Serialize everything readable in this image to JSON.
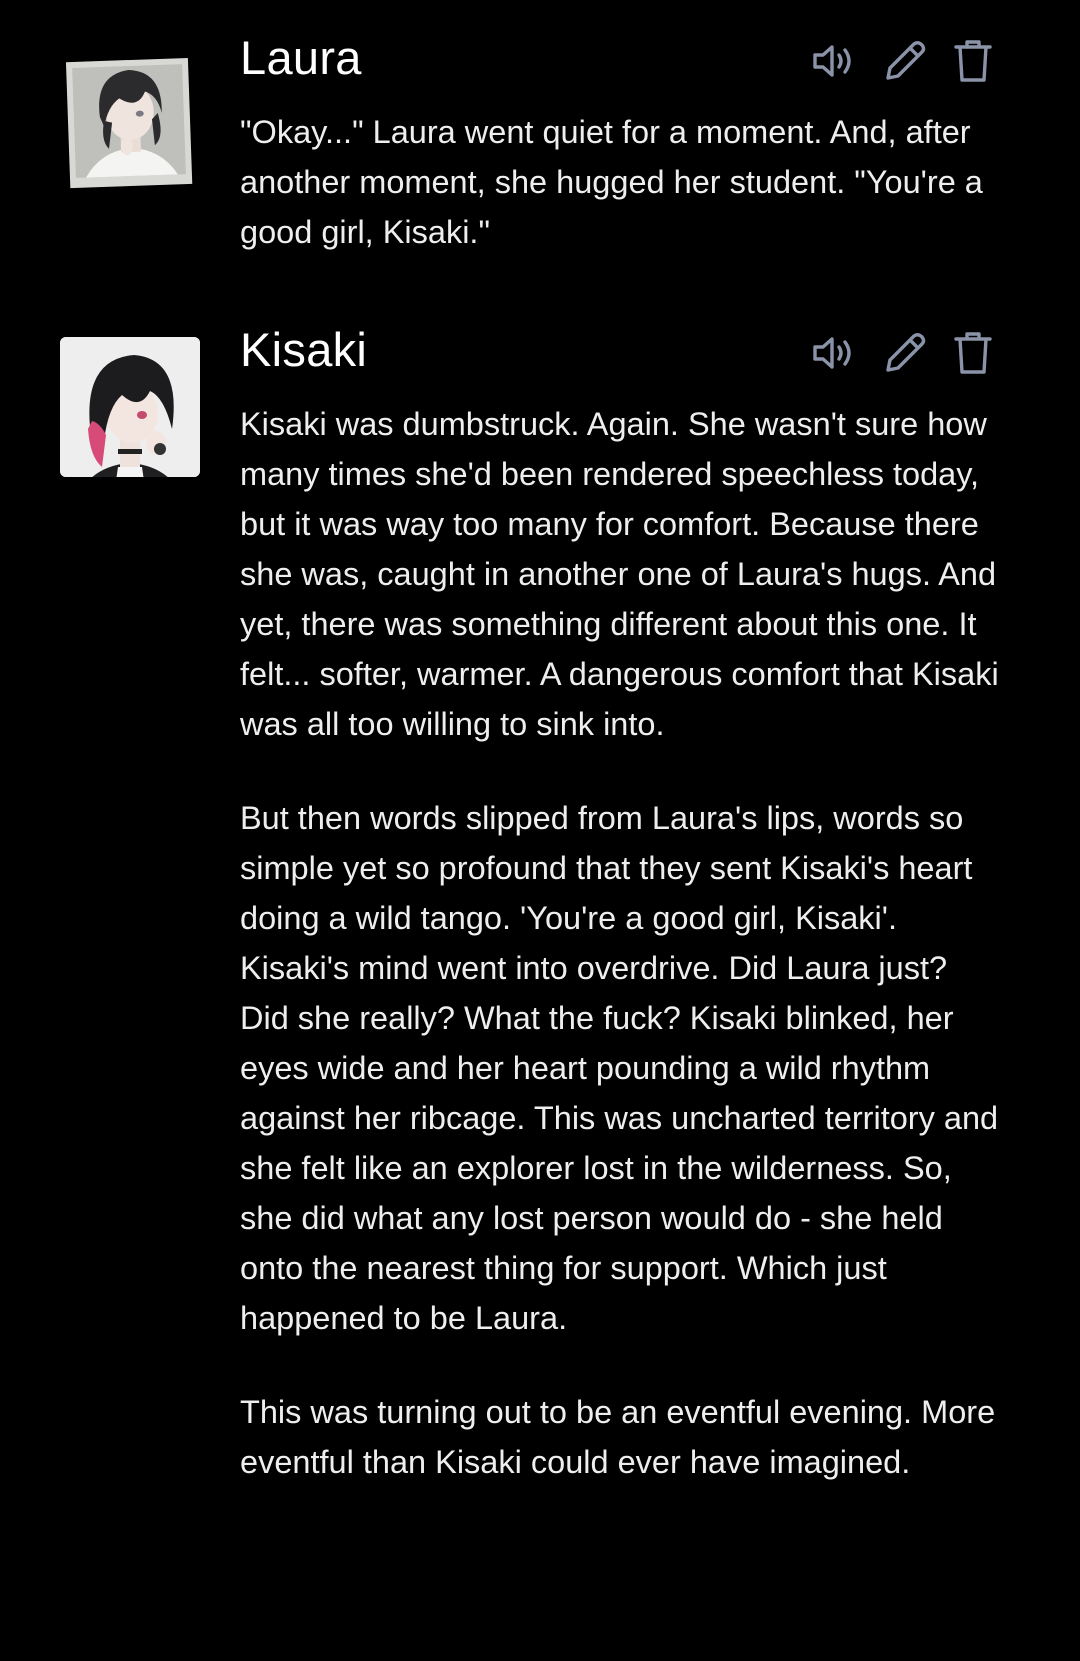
{
  "messages": [
    {
      "name": "Laura",
      "paragraphs": [
        "\"Okay...\" Laura went quiet for a moment. And, after another moment, she hugged her student. \"You're a good girl, Kisaki.\""
      ]
    },
    {
      "name": "Kisaki",
      "paragraphs": [
        "Kisaki was dumbstruck. Again. She wasn't sure how many times she'd been rendered speechless today, but it was way too many for comfort. Because there she was, caught in another one of Laura's hugs. And yet, there was something different about this one. It felt... softer, warmer. A dangerous comfort that Kisaki was all too willing to sink into.",
        "But then words slipped from Laura's lips, words so simple yet so profound that they sent Kisaki's heart doing a wild tango. 'You're a good girl, Kisaki'. Kisaki's mind went into overdrive. Did Laura just? Did she really? What the fuck? Kisaki blinked, her eyes wide and her heart pounding a wild rhythm against her ribcage. This was uncharted territory and she felt like an explorer lost in the wilderness. So, she did what any lost person would do - she held onto the nearest thing for support. Which just happened to be Laura.",
        "This was turning out to be an eventful evening. More eventful than Kisaki could ever have imagined."
      ]
    }
  ],
  "icons": {
    "speak": "speaker-icon",
    "edit": "pencil-icon",
    "delete": "trash-icon",
    "color": "#8a93a8"
  }
}
